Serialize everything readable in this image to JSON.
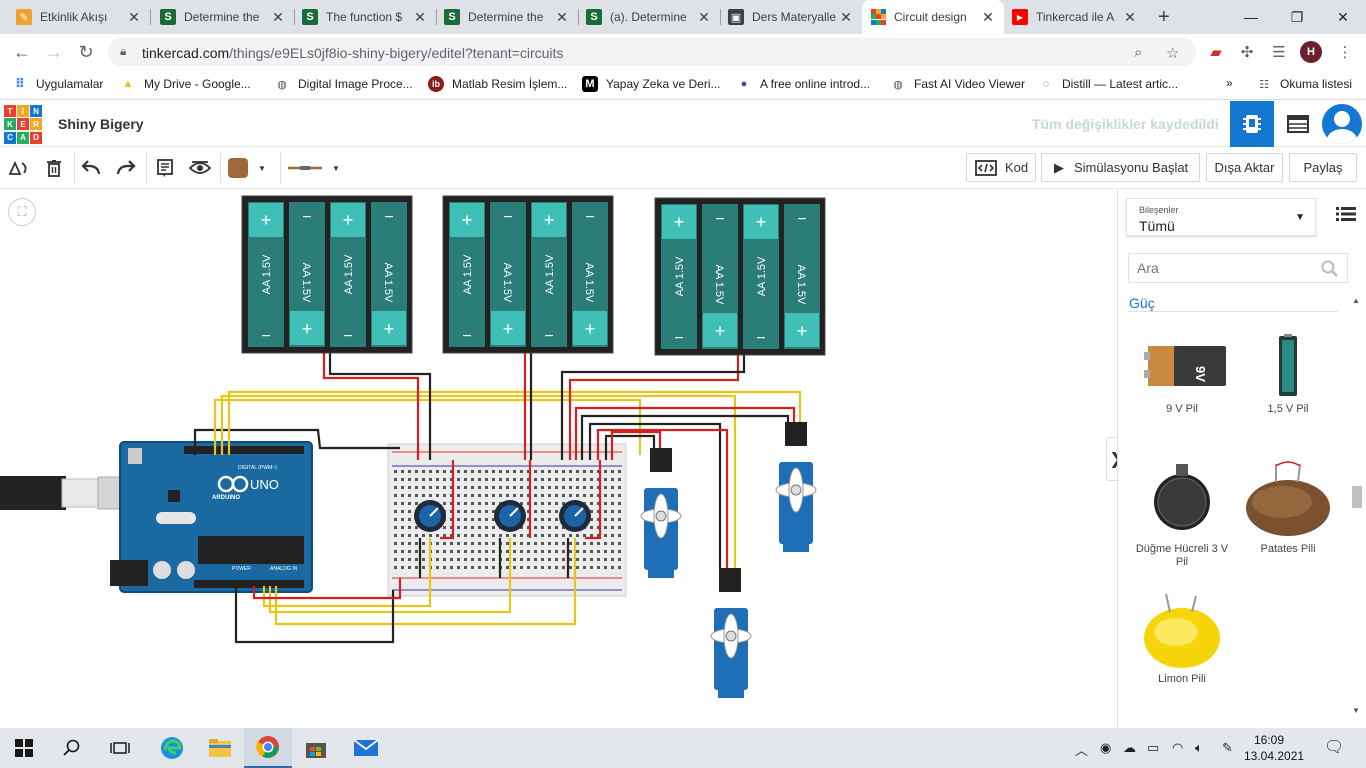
{
  "browser": {
    "tabs": [
      {
        "title": "Etkinlik Akışı",
        "icon": "pencil-favicon"
      },
      {
        "title": "Determine the",
        "icon": "s-favicon"
      },
      {
        "title": "The function $",
        "icon": "s-favicon"
      },
      {
        "title": "Determine the",
        "icon": "s-favicon"
      },
      {
        "title": "(a). Determine",
        "icon": "s-favicon"
      },
      {
        "title": "Ders Materyalle",
        "icon": "course-favicon"
      },
      {
        "title": "Circuit design",
        "icon": "tinkercad-favicon"
      },
      {
        "title": "Tinkercad ile A",
        "icon": "youtube-favicon"
      }
    ],
    "url_host": "tinkercad.com",
    "url_path": "/things/e9ELs0jf8io-shiny-bigery/editel?tenant=circuits",
    "profile_initial": "H",
    "bookmarks": [
      {
        "label": "Uygulamalar"
      },
      {
        "label": "My Drive - Google..."
      },
      {
        "label": "Digital Image Proce..."
      },
      {
        "label": "Matlab Resim İşlem..."
      },
      {
        "label": "Yapay Zeka ve Deri..."
      },
      {
        "label": "A free online introd..."
      },
      {
        "label": "Fast AI Video Viewer"
      },
      {
        "label": "Distill — Latest artic..."
      }
    ],
    "reading_list": "Okuma listesi",
    "more": "»"
  },
  "app": {
    "logo_letters": [
      "T",
      "I",
      "N",
      "K",
      "E",
      "R",
      "C",
      "A",
      "D"
    ],
    "project_name": "Shiny Bigery",
    "save_status": "Tüm değişiklikler kaydedildi"
  },
  "toolbar": {
    "code_label": "Kod",
    "simulate_label": "Simülasyonu Başlat",
    "export_label": "Dışa Aktar",
    "share_label": "Paylaş",
    "wire_color": "#a0693c"
  },
  "canvas": {
    "battery_cell_label": "AA 1.5V",
    "arduino_model": "UNO",
    "arduino_brand": "ARDUINO",
    "arduino_digital_label": "DIGITAL (PWM~)",
    "arduino_power_label": "POWER",
    "arduino_analog_label": "ANALOG IN"
  },
  "panel": {
    "select_label": "Bileşenler",
    "select_value": "Tümü",
    "search_placeholder": "Ara",
    "group_title": "Güç",
    "components": [
      {
        "label": "9 V Pil"
      },
      {
        "label": "1,5 V Pil"
      },
      {
        "label": "Düğme Hücreli 3 V Pil"
      },
      {
        "label": "Patates Pili"
      },
      {
        "label": "Limon Pili"
      }
    ]
  },
  "taskbar": {
    "time": "16:09",
    "date": "13.04.2021"
  }
}
